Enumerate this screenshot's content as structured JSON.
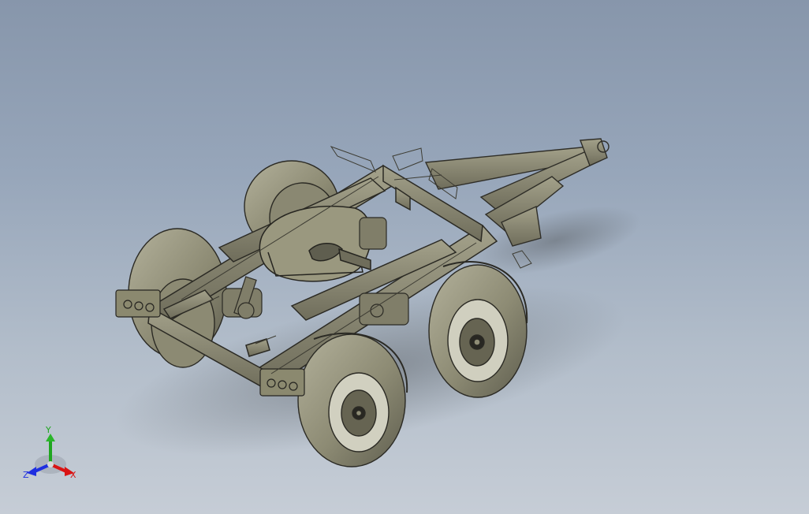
{
  "viewport": {
    "background_top": "#8796ab",
    "background_bottom": "#c6cdd6",
    "model_color": "#8f8d76",
    "model_shadow": "#6d6b5a",
    "shadow_color": "#7b8187"
  },
  "triad": {
    "labels": {
      "x": "X",
      "y": "Y",
      "z": "Z"
    },
    "colors": {
      "x": "#d91414",
      "y": "#1fa61f",
      "z": "#1f2fe0"
    },
    "icon": "coordinate-triad-icon"
  }
}
